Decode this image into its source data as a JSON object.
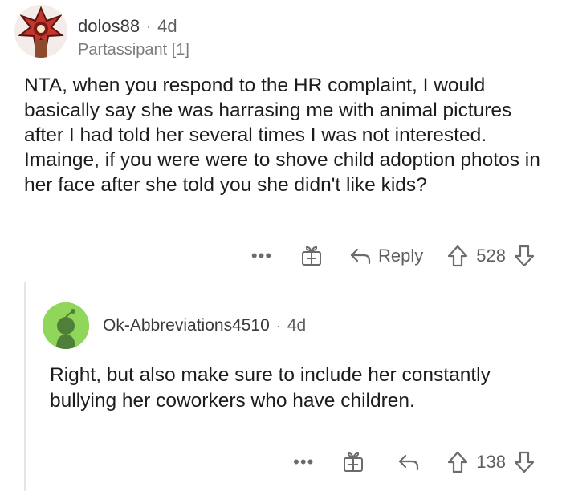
{
  "comment": {
    "author": "dolos88",
    "separator": "·",
    "time": "4d",
    "flair": "Partassipant [1]",
    "body": "NTA, when you respond to the HR complaint, I would basically say she was harrasing me with animal pictures after I had told her several times I was not interested. Imainge, if you were were to shove child adoption photos in her face after she told you she didn't like kids?",
    "actions": {
      "more_label": "•••",
      "reply_label": "Reply",
      "score": "528"
    }
  },
  "reply": {
    "author": "Ok-Abbreviations4510",
    "separator": "·",
    "time": "4d",
    "body": "Right, but also make sure to include her constantly bullying her coworkers who have children.",
    "actions": {
      "more_label": "•••",
      "score": "138"
    }
  },
  "icons": {
    "avatar1": "demogorgon-avatar-icon",
    "avatar2": "reddit-snoo-avatar-icon",
    "award": "gift-award-icon",
    "reply": "reply-arrow-icon",
    "upvote": "upvote-arrow-icon",
    "downvote": "downvote-arrow-icon"
  },
  "colors": {
    "text": "#1c1c1c",
    "muted": "#6b6b6b",
    "avatar2_bg": "#8fd65a",
    "thread_line": "#e6e6e6"
  }
}
